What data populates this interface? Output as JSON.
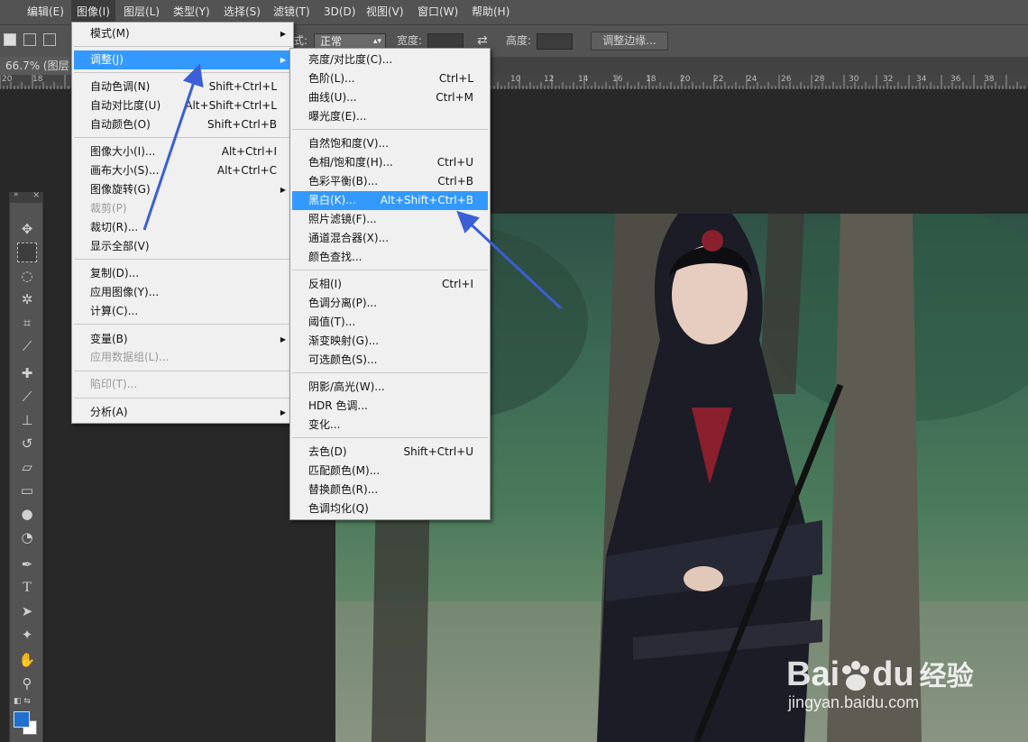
{
  "menubar": {
    "items": [
      "编辑(E)",
      "图像(I)",
      "图层(L)",
      "类型(Y)",
      "选择(S)",
      "滤镜(T)",
      "3D(D)",
      "视图(V)",
      "窗口(W)",
      "帮助(H)"
    ]
  },
  "options": {
    "style_label": "式:",
    "style_value": "正常",
    "width_label": "宽度:",
    "height_label": "高度:",
    "refine_edge": "调整边缘..."
  },
  "doc_tab": "66.7% (图层",
  "ruler": {
    "ticks": [
      "20",
      "18",
      "10",
      "12",
      "14",
      "16",
      "18",
      "20",
      "22",
      "24",
      "26",
      "28",
      "30",
      "32",
      "34",
      "36",
      "38"
    ]
  },
  "image_menu": {
    "items": [
      {
        "label": "模式(M)",
        "shortcut": "",
        "submenu": true
      },
      {
        "label": "调整(J)",
        "shortcut": "",
        "submenu": true,
        "highlighted": true
      },
      {
        "label": "自动色调(N)",
        "shortcut": "Shift+Ctrl+L"
      },
      {
        "label": "自动对比度(U)",
        "shortcut": "Alt+Shift+Ctrl+L"
      },
      {
        "label": "自动颜色(O)",
        "shortcut": "Shift+Ctrl+B"
      },
      {
        "label": "图像大小(I)...",
        "shortcut": "Alt+Ctrl+I"
      },
      {
        "label": "画布大小(S)...",
        "shortcut": "Alt+Ctrl+C"
      },
      {
        "label": "图像旋转(G)",
        "shortcut": "",
        "submenu": true
      },
      {
        "label": "裁剪(P)",
        "shortcut": "",
        "disabled": true
      },
      {
        "label": "裁切(R)...",
        "shortcut": ""
      },
      {
        "label": "显示全部(V)",
        "shortcut": ""
      },
      {
        "label": "复制(D)...",
        "shortcut": ""
      },
      {
        "label": "应用图像(Y)...",
        "shortcut": ""
      },
      {
        "label": "计算(C)...",
        "shortcut": ""
      },
      {
        "label": "变量(B)",
        "shortcut": "",
        "submenu": true
      },
      {
        "label": "应用数据组(L)...",
        "shortcut": "",
        "disabled": true
      },
      {
        "label": "陷印(T)...",
        "shortcut": "",
        "disabled": true
      },
      {
        "label": "分析(A)",
        "shortcut": "",
        "submenu": true
      }
    ]
  },
  "adjust_menu": {
    "items": [
      {
        "label": "亮度/对比度(C)...",
        "shortcut": ""
      },
      {
        "label": "色阶(L)...",
        "shortcut": "Ctrl+L"
      },
      {
        "label": "曲线(U)...",
        "shortcut": "Ctrl+M"
      },
      {
        "label": "曝光度(E)...",
        "shortcut": ""
      },
      {
        "label": "自然饱和度(V)...",
        "shortcut": ""
      },
      {
        "label": "色相/饱和度(H)...",
        "shortcut": "Ctrl+U"
      },
      {
        "label": "色彩平衡(B)...",
        "shortcut": "Ctrl+B"
      },
      {
        "label": "黑白(K)...",
        "shortcut": "Alt+Shift+Ctrl+B",
        "highlighted": true
      },
      {
        "label": "照片滤镜(F)...",
        "shortcut": ""
      },
      {
        "label": "通道混合器(X)...",
        "shortcut": ""
      },
      {
        "label": "颜色查找...",
        "shortcut": ""
      },
      {
        "label": "反相(I)",
        "shortcut": "Ctrl+I"
      },
      {
        "label": "色调分离(P)...",
        "shortcut": ""
      },
      {
        "label": "阈值(T)...",
        "shortcut": ""
      },
      {
        "label": "渐变映射(G)...",
        "shortcut": ""
      },
      {
        "label": "可选颜色(S)...",
        "shortcut": ""
      },
      {
        "label": "阴影/高光(W)...",
        "shortcut": ""
      },
      {
        "label": "HDR 色调...",
        "shortcut": ""
      },
      {
        "label": "变化...",
        "shortcut": ""
      },
      {
        "label": "去色(D)",
        "shortcut": "Shift+Ctrl+U"
      },
      {
        "label": "匹配颜色(M)...",
        "shortcut": ""
      },
      {
        "label": "替换颜色(R)...",
        "shortcut": ""
      },
      {
        "label": "色调均化(Q)",
        "shortcut": ""
      }
    ]
  },
  "watermark": {
    "brand": "Bai",
    "brand2": "du",
    "cn": "经验",
    "url": "jingyan.baidu.com"
  },
  "colors": {
    "highlight": "#3399ff",
    "arrow": "#3a5fd6",
    "foreground_swatch": "#1e6fd0",
    "background_swatch": "#ffffff"
  },
  "icons": [
    "move-icon",
    "marquee-icon",
    "lasso-icon",
    "magic-wand-icon",
    "crop-icon",
    "eyedropper-icon",
    "healing-icon",
    "brush-icon",
    "stamp-icon",
    "history-brush-icon",
    "eraser-icon",
    "gradient-icon",
    "blur-icon",
    "dodge-icon",
    "pen-icon",
    "type-icon",
    "path-select-icon",
    "shape-icon",
    "hand-icon",
    "zoom-icon"
  ]
}
